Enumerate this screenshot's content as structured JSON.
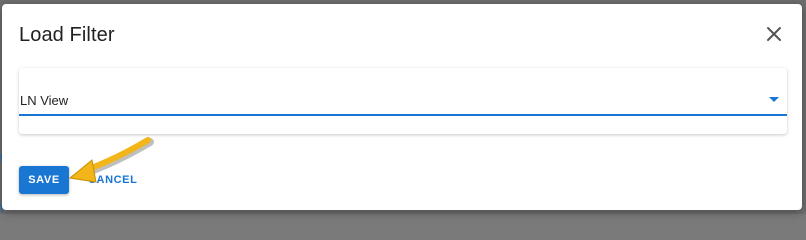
{
  "dialog": {
    "title": "Load Filter",
    "close_icon": "close-icon"
  },
  "filter_select": {
    "value": "LN View",
    "arrow_icon": "dropdown-arrow-icon"
  },
  "actions": {
    "save_label": "SAVE",
    "cancel_label": "CANCEL"
  },
  "colors": {
    "accent": "#1976d2",
    "annotation_arrow": "#f2b51a"
  }
}
